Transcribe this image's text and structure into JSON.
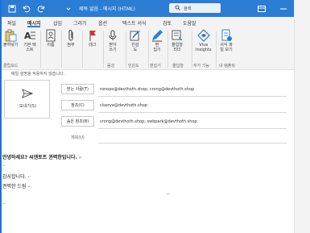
{
  "window": {
    "title": "제목 없음 - 메시지 (HTML)",
    "search_placeholder": "검색"
  },
  "menu": {
    "items": [
      "파일",
      "메시지",
      "삽입",
      "그리기",
      "옵션",
      "텍스트 서식",
      "검토",
      "도움말"
    ],
    "active": "메시지"
  },
  "ribbon": {
    "buttons": {
      "paste": "붙여넣기",
      "basic_text": "기본 텍\n스트",
      "names": "이름",
      "attach": "첨부",
      "tags": "태그",
      "dictate": "받아\n쓰기",
      "sensitivity": "민감\n도",
      "editor": "편\n집기",
      "immersive_reader": "몰입형\n리더",
      "viva_insights": "Viva\nInsights",
      "my_templates": "서식 파\n일 보기"
    },
    "groups": [
      "클립보드",
      "음성",
      "민감도",
      "편집기",
      "몰입형",
      "추가 기능",
      "내 템플릿"
    ]
  },
  "info_bar": "메일 설명을 적용하지 않습니다.",
  "compose": {
    "send_label": "보내기(S)",
    "to_label": "받는 사람(T)",
    "to_value": "ronopo@devthoth.shop; crong@devthoth.shop",
    "cc_label": "참조(C)",
    "cc_value": "clserve@devthoth.shop",
    "bcc_label": "숨은 참조(B)",
    "bcc_value": "crong@devthoth.shop; swbpark@devthoth.shop",
    "subject_label": "제목(U)"
  },
  "body": {
    "greeting": "안녕하세요? 씨엔토트 권력한입니다.",
    "thanks": "감사합니다.",
    "signature": "권력한 드림",
    "paragraph_mark": "↵"
  },
  "colors": {
    "titlebar": "#2b7cd3",
    "accent": "#2b7cd3",
    "ribbon_bg": "#f3f3f3"
  }
}
